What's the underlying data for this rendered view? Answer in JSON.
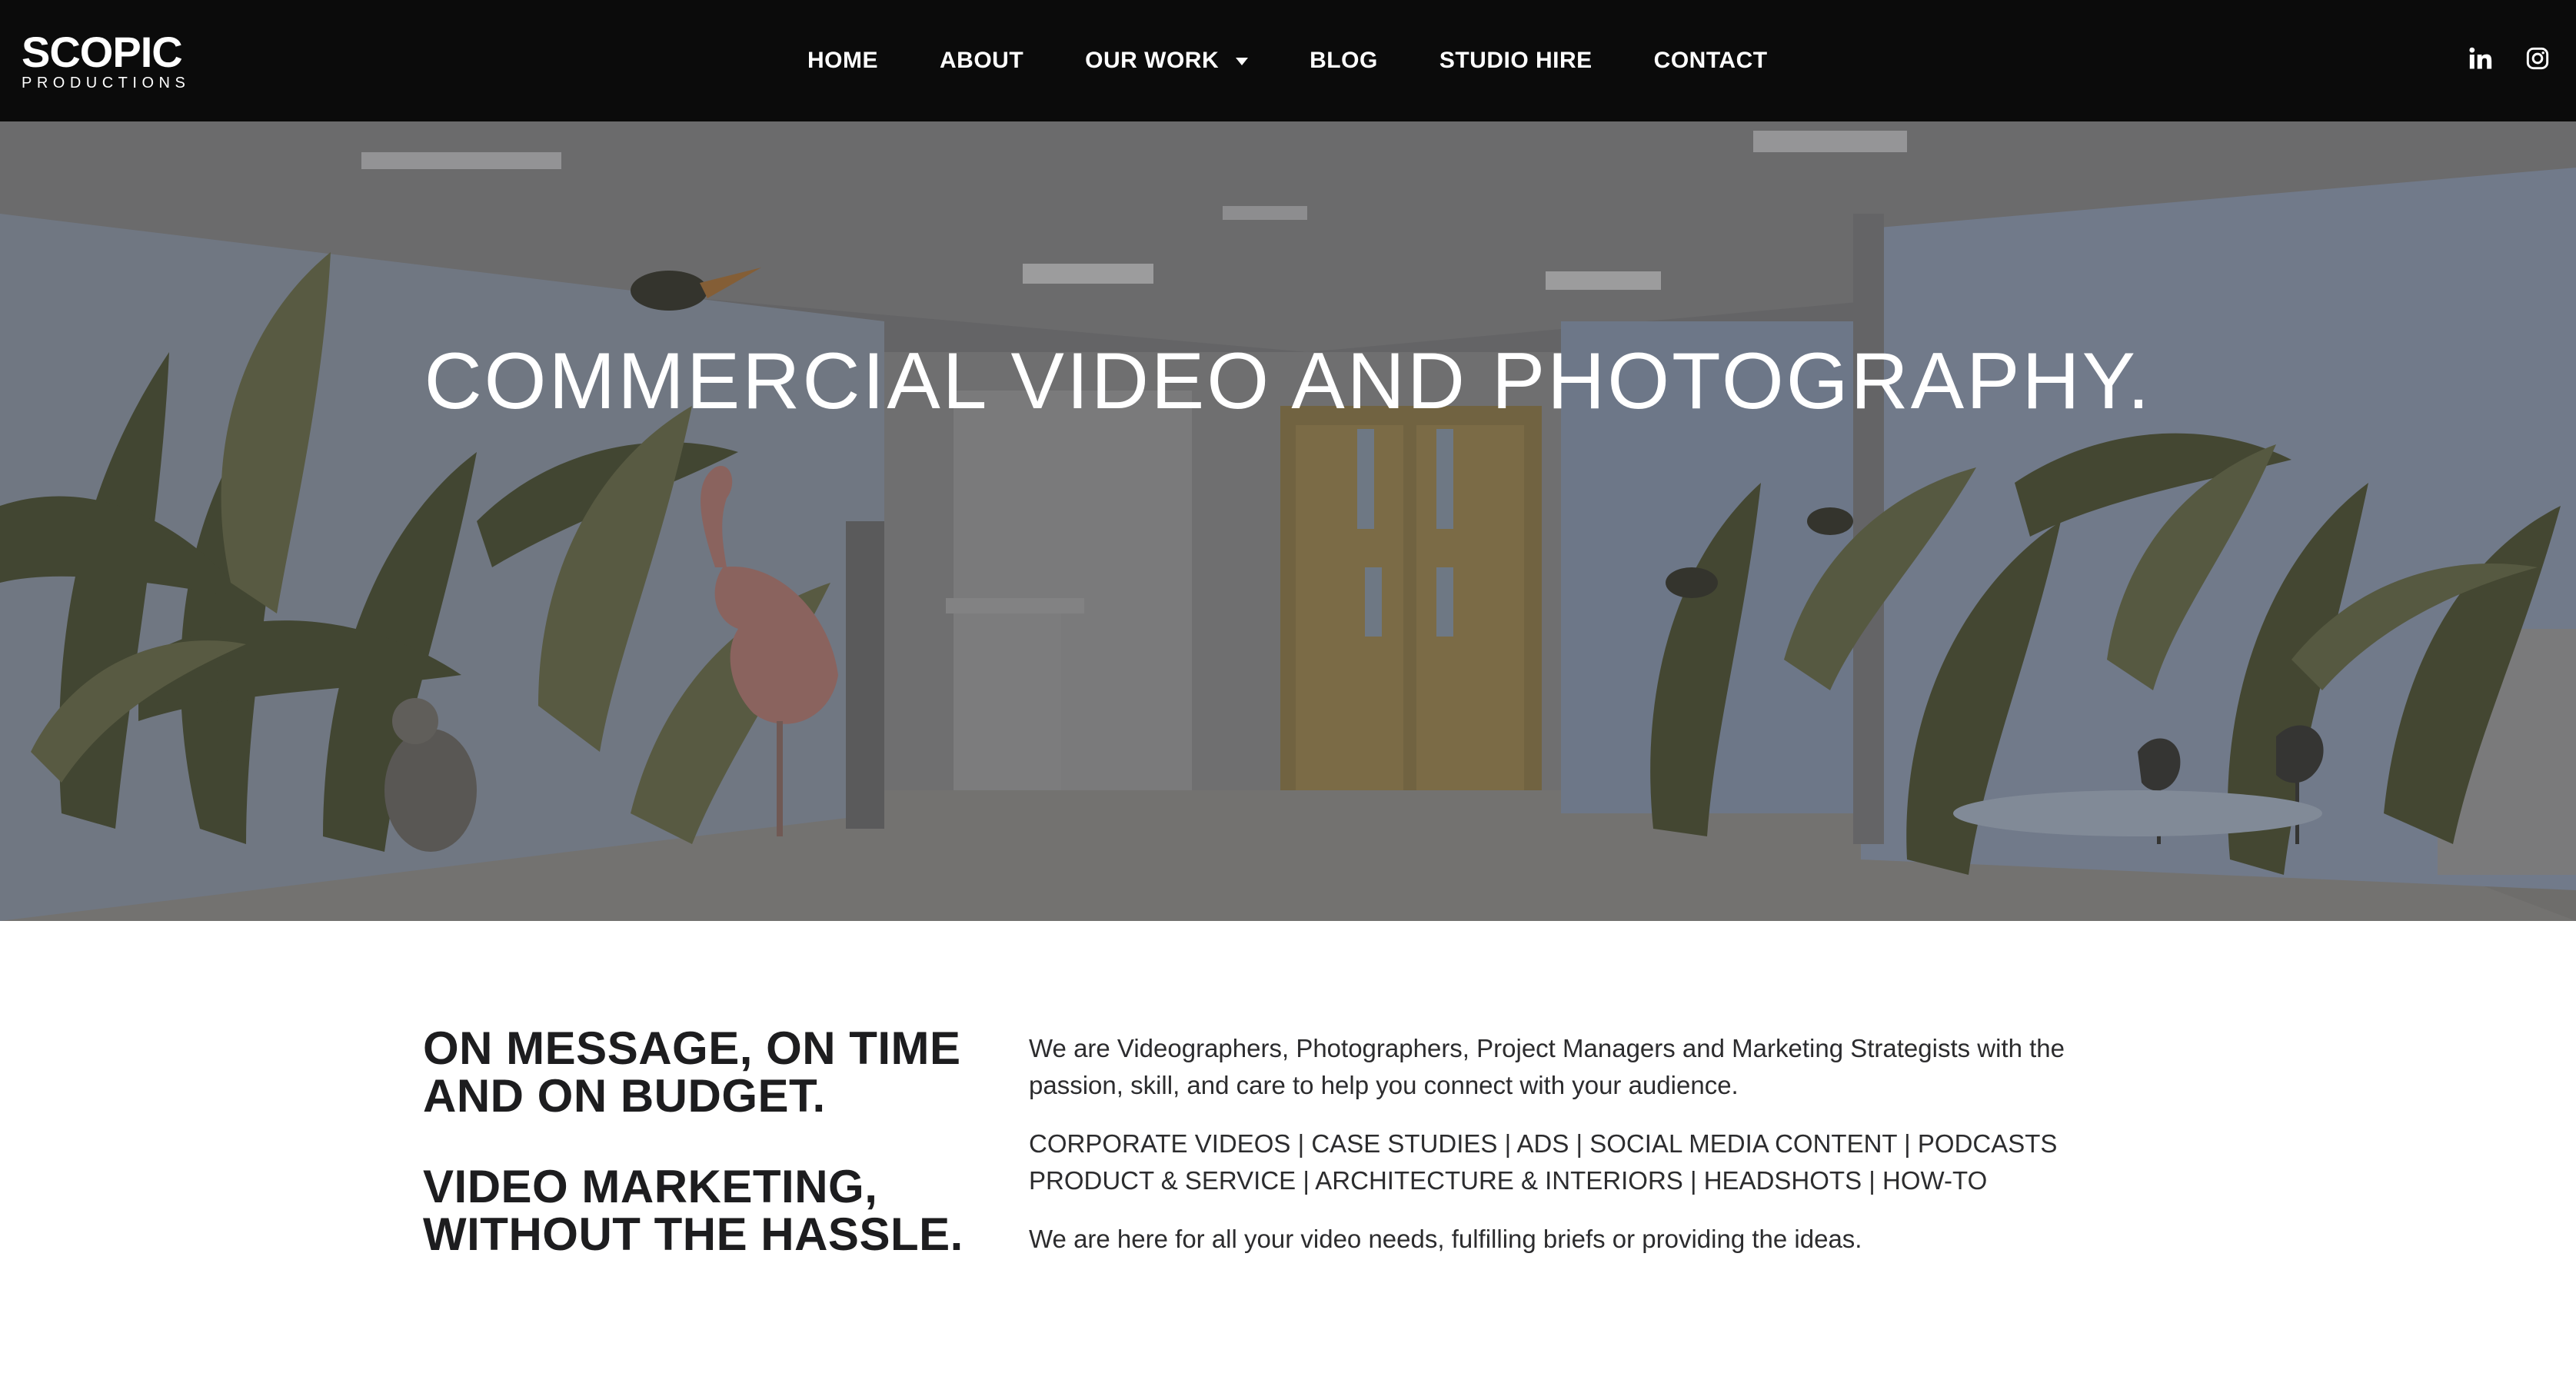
{
  "brand": {
    "name": "SCOPIC",
    "tagline": "PRODUCTIONS"
  },
  "nav": {
    "items": [
      {
        "label": "HOME"
      },
      {
        "label": "ABOUT"
      },
      {
        "label": "OUR WORK",
        "has_dropdown": true
      },
      {
        "label": "BLOG"
      },
      {
        "label": "STUDIO HIRE"
      },
      {
        "label": "CONTACT"
      }
    ]
  },
  "social": {
    "icons": [
      "linkedin-icon",
      "instagram-icon"
    ]
  },
  "hero": {
    "title": "COMMERCIAL VIDEO AND PHOTOGRAPHY."
  },
  "intro": {
    "headline_1": "ON MESSAGE, ON TIME AND ON BUDGET.",
    "headline_2": "VIDEO MARKETING, WITHOUT THE HASSLE.",
    "paragraph_1": "We are Videographers, Photographers, Project Managers and Marketing Strategists with the passion, skill, and care to help you connect with your audience.",
    "paragraph_2": "CORPORATE VIDEOS | CASE STUDIES | ADS | SOCIAL MEDIA CONTENT | PODCASTS PRODUCT & SERVICE | ARCHITECTURE & INTERIORS | HEADSHOTS | HOW-TO",
    "paragraph_3": "We are here for all your video needs, fulfilling briefs or providing the ideas."
  },
  "colors": {
    "header_bg": "#0b0b0b",
    "text_dark": "#1d1d1f",
    "hero_wall": "#9fb0c8",
    "plant_dark": "#4f5437",
    "flamingo": "#c98a86",
    "door_wood": "#a88a4e"
  }
}
